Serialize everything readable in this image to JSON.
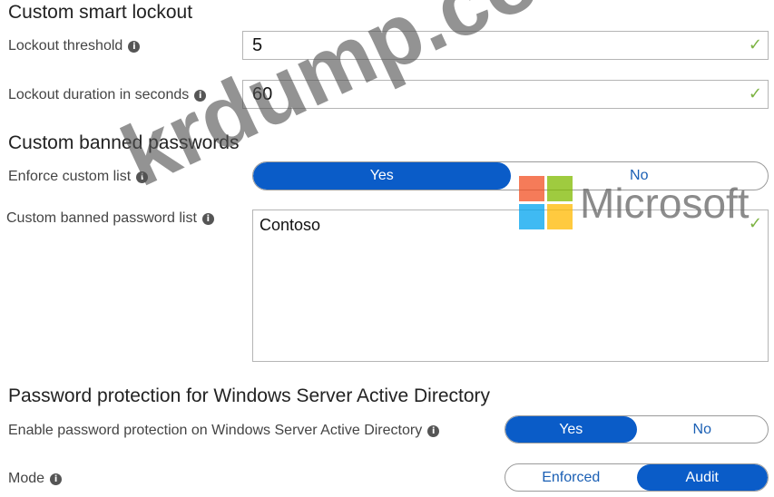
{
  "lockout": {
    "title": "Custom smart lockout",
    "threshold": {
      "label": "Lockout threshold",
      "value": "5"
    },
    "duration": {
      "label": "Lockout duration in seconds",
      "value": "60"
    }
  },
  "banned": {
    "title": "Custom banned passwords",
    "enforce": {
      "label": "Enforce custom list",
      "yes": "Yes",
      "no": "No",
      "selected": "Yes"
    },
    "list": {
      "label": "Custom banned password list",
      "value": "Contoso"
    }
  },
  "ad": {
    "title": "Password protection for Windows Server Active Directory",
    "enable": {
      "label": "Enable password protection on Windows Server Active Directory",
      "yes": "Yes",
      "no": "No",
      "selected": "Yes"
    },
    "mode": {
      "label": "Mode",
      "enforced": "Enforced",
      "audit": "Audit",
      "selected": "Audit"
    }
  },
  "watermark": {
    "text": "krdump.com",
    "brand": "Microsoft"
  },
  "icons": {
    "info": "info-icon",
    "check": "checkmark-icon"
  },
  "colors": {
    "accent": "#0a5cc8",
    "check": "#7cb342",
    "ms_red": "#f25022",
    "ms_green": "#7fba00",
    "ms_blue": "#00a4ef",
    "ms_yellow": "#ffb900"
  }
}
